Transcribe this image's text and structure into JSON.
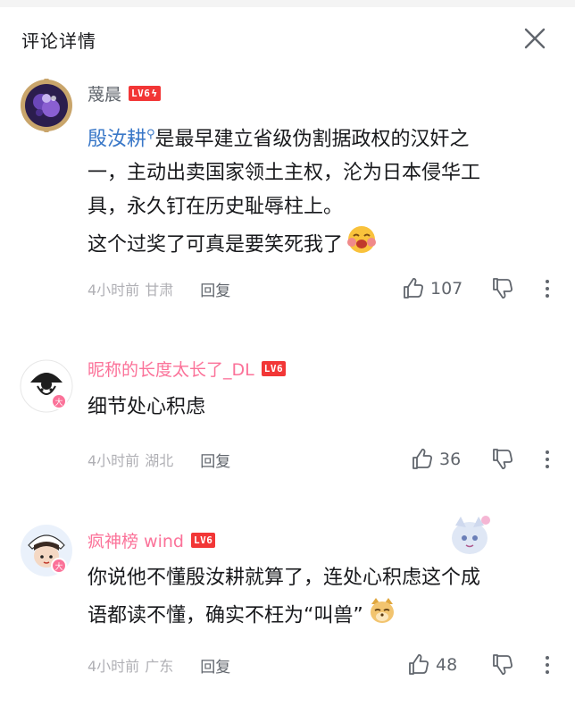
{
  "header": {
    "title": "评论详情",
    "close_icon": "close-icon"
  },
  "colors": {
    "vip_pink": "#fb7299",
    "level_red": "#f23636",
    "meta_gray": "#b0b0b5",
    "mention_blue": "#3a78c8"
  },
  "comments": [
    {
      "username": "蔑晨",
      "username_color": "#61666d",
      "level": "LV6",
      "level_bolt": "ϟ",
      "mention": "殷汝耕",
      "lines": [
        "是最早建立省级伪割据政权的汉奸之",
        "一，主动出卖国家领土主权，沦为日本侵华工",
        "具，永久钉在历史耻辱柱上。",
        "这个过奖了可真是要笑死我了"
      ],
      "emoji": "laughing-emoji",
      "time": "4小时前",
      "location": "甘肃",
      "reply": "回复",
      "likes": "107"
    },
    {
      "username": "昵称的长度太长了_DL",
      "username_color": "#fb7299",
      "level": "LV6",
      "lines": [
        "细节处心积虑"
      ],
      "time": "4小时前",
      "location": "湖北",
      "reply": "回复",
      "likes": "36"
    },
    {
      "username": "疯神榜 wind",
      "username_color": "#fb7299",
      "level": "LV6",
      "lines": [
        "你说他不懂殷汝耕就算了，连处心积虑这个成",
        "语都读不懂，确实不枉为“叫兽”"
      ],
      "emoji": "doge-emoji",
      "time": "4小时前",
      "location": "广东",
      "reply": "回复",
      "likes": "48"
    }
  ]
}
